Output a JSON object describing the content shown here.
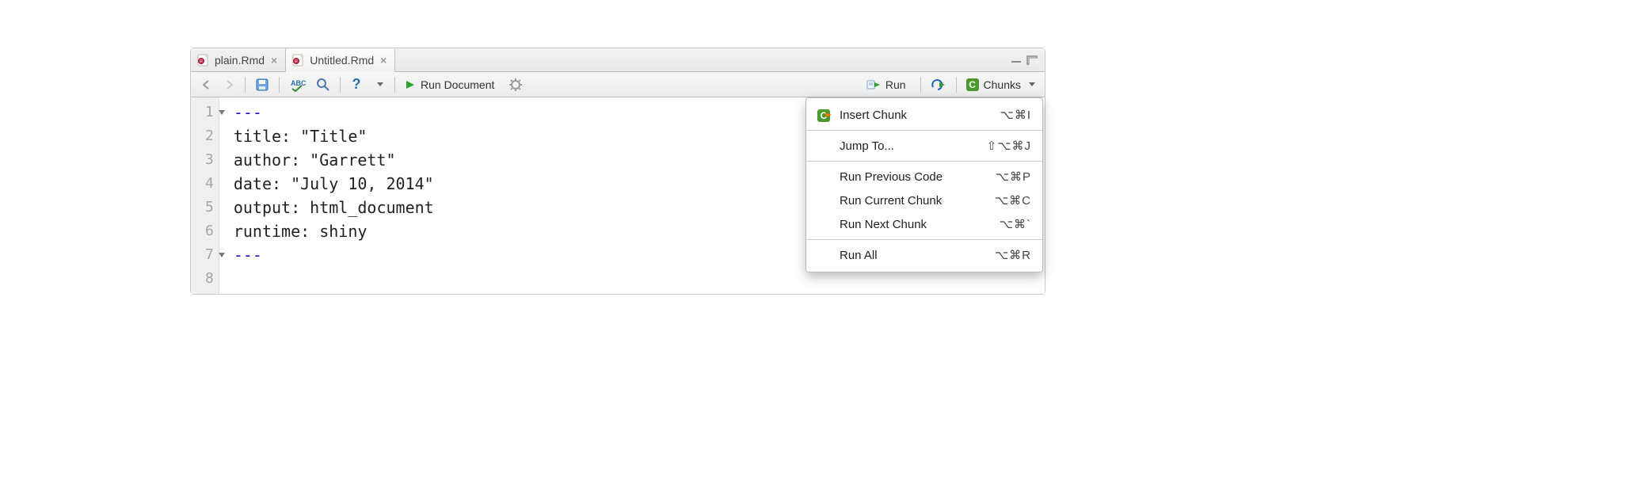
{
  "tabs": [
    {
      "label": "plain.Rmd",
      "active": false
    },
    {
      "label": "Untitled.Rmd",
      "active": true
    }
  ],
  "toolbar": {
    "run_document_label": "Run Document",
    "run_label": "Run",
    "chunks_label": "Chunks"
  },
  "code": {
    "lines": [
      {
        "num": "1",
        "fold": true,
        "text": "---",
        "delim": true
      },
      {
        "num": "2",
        "text": "title: \"Title\""
      },
      {
        "num": "3",
        "text": "author: \"Garrett\""
      },
      {
        "num": "4",
        "text": "date: \"July 10, 2014\""
      },
      {
        "num": "5",
        "text": "output: html_document"
      },
      {
        "num": "6",
        "text": "runtime: shiny"
      },
      {
        "num": "7",
        "fold": true,
        "text": "---",
        "delim": true
      },
      {
        "num": "8",
        "text": ""
      }
    ]
  },
  "menu": {
    "items": [
      {
        "label": "Insert Chunk",
        "shortcut": "⌥⌘I",
        "icon": "insert"
      },
      {
        "sep": true
      },
      {
        "label": "Jump To...",
        "shortcut": "⇧⌥⌘J"
      },
      {
        "sep": true
      },
      {
        "label": "Run Previous Code",
        "shortcut": "⌥⌘P"
      },
      {
        "label": "Run Current Chunk",
        "shortcut": "⌥⌘C"
      },
      {
        "label": "Run Next Chunk",
        "shortcut": "⌥⌘`"
      },
      {
        "sep": true
      },
      {
        "label": "Run All",
        "shortcut": "⌥⌘R"
      }
    ]
  }
}
